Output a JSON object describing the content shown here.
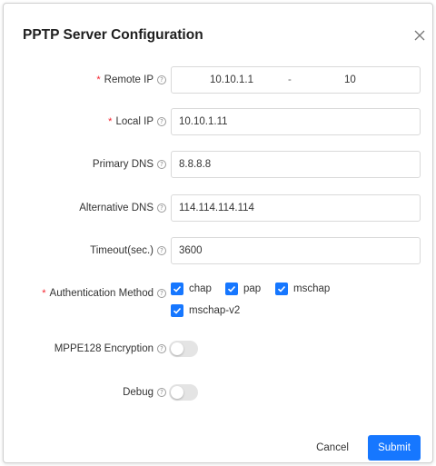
{
  "dialog": {
    "title": "PPTP Server Configuration",
    "close_icon": "close-icon"
  },
  "form": {
    "remote_ip": {
      "required": "*",
      "label": "Remote IP",
      "start": "10.10.1.1",
      "separator": "-",
      "end": "10"
    },
    "local_ip": {
      "required": "*",
      "label": "Local IP",
      "value": "10.10.1.11"
    },
    "primary_dns": {
      "label": "Primary DNS",
      "value": "8.8.8.8"
    },
    "alternative_dns": {
      "label": "Alternative DNS",
      "value": "114.114.114.114"
    },
    "timeout": {
      "label": "Timeout(sec.)",
      "value": "3600"
    },
    "auth": {
      "required": "*",
      "label": "Authentication Method",
      "options": [
        {
          "label": "chap",
          "checked": true
        },
        {
          "label": "pap",
          "checked": true
        },
        {
          "label": "mschap",
          "checked": true
        },
        {
          "label": "mschap-v2",
          "checked": true
        }
      ]
    },
    "mppe": {
      "label": "MPPE128 Encryption",
      "enabled": false
    },
    "debug": {
      "label": "Debug",
      "enabled": false
    }
  },
  "help_glyph": "?",
  "buttons": {
    "cancel": "Cancel",
    "submit": "Submit"
  },
  "colors": {
    "primary": "#1677ff",
    "required": "#f5222d",
    "switch_off": "#e4e4e4"
  }
}
